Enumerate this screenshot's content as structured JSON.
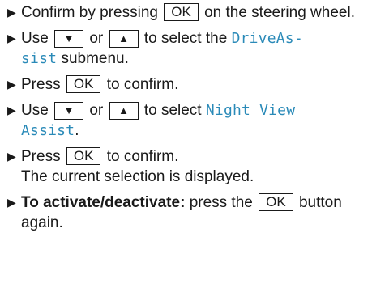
{
  "steps": [
    {
      "pre": "Confirm by pressing",
      "key": "OK",
      "post": "on the steering wheel."
    },
    {
      "pre": "Use",
      "key_down": "▼",
      "mid": "or",
      "key_up": "▲",
      "post": "to select the",
      "menu_a": "DriveAs-",
      "menu_b": "sist",
      "tail": "submenu."
    },
    {
      "pre": "Press",
      "key": "OK",
      "post": "to confirm."
    },
    {
      "pre": "Use",
      "key_down": "▼",
      "mid": "or",
      "key_up": "▲",
      "post": "to select",
      "menu_a": "Night View",
      "menu_b": "Assist",
      "tail": "."
    },
    {
      "pre": "Press",
      "key": "OK",
      "post": "to confirm.",
      "result": "The current selection is displayed."
    },
    {
      "bold_label": "To activate/deactivate:",
      "pre": "press the",
      "key": "OK",
      "post": "button again."
    }
  ],
  "bullet": "▶",
  "colors": {
    "display_text": "#2a8ab8",
    "text": "#1a1a1a"
  }
}
